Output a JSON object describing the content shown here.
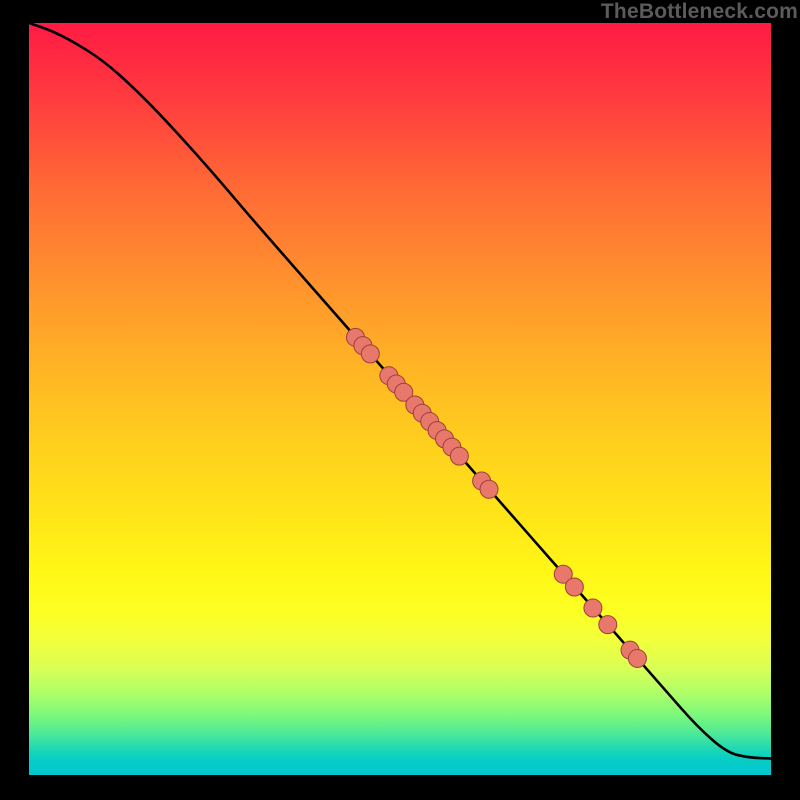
{
  "watermark": "TheBottleneck.com",
  "chart_data": {
    "type": "line",
    "title": "",
    "xlabel": "",
    "ylabel": "",
    "xlim": [
      0,
      100
    ],
    "ylim": [
      0,
      100
    ],
    "curve": {
      "x": [
        0,
        3,
        6,
        10,
        14,
        18,
        24,
        30,
        38,
        46,
        54,
        62,
        70,
        78,
        86,
        90,
        94,
        97,
        100
      ],
      "y": [
        100,
        99,
        97.5,
        95,
        91.5,
        87.5,
        81,
        74,
        65,
        56,
        47,
        38,
        29,
        20,
        11,
        6.5,
        3,
        2.3,
        2.2
      ]
    },
    "markers": [
      {
        "x": 44,
        "y": 58.2
      },
      {
        "x": 45,
        "y": 57.1
      },
      {
        "x": 46,
        "y": 56.0
      },
      {
        "x": 48.5,
        "y": 53.1
      },
      {
        "x": 49.5,
        "y": 52.0
      },
      {
        "x": 50.5,
        "y": 50.9
      },
      {
        "x": 52,
        "y": 49.2
      },
      {
        "x": 53,
        "y": 48.1
      },
      {
        "x": 54,
        "y": 47.0
      },
      {
        "x": 55,
        "y": 45.8
      },
      {
        "x": 56,
        "y": 44.7
      },
      {
        "x": 57,
        "y": 43.6
      },
      {
        "x": 58,
        "y": 42.4
      },
      {
        "x": 61,
        "y": 39.1
      },
      {
        "x": 62,
        "y": 38.0
      },
      {
        "x": 72,
        "y": 26.7
      },
      {
        "x": 73.5,
        "y": 25.0
      },
      {
        "x": 76,
        "y": 22.2
      },
      {
        "x": 78,
        "y": 20.0
      },
      {
        "x": 81,
        "y": 16.6
      },
      {
        "x": 82,
        "y": 15.5
      }
    ],
    "marker_style": {
      "fill": "#e8786c",
      "stroke": "#9c4039",
      "r": 9
    }
  }
}
